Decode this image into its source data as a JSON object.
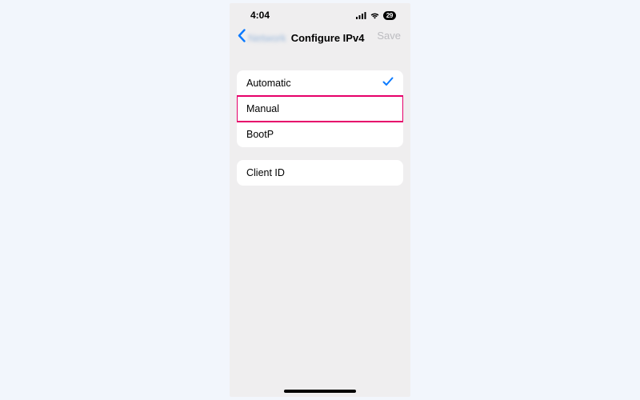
{
  "status": {
    "time": "4:04",
    "battery": "29"
  },
  "nav": {
    "back_label": "Network",
    "title": "Configure IPv4",
    "save": "Save"
  },
  "options": {
    "automatic": "Automatic",
    "manual": "Manual",
    "bootp": "BootP"
  },
  "fields": {
    "client_id": "Client ID"
  }
}
